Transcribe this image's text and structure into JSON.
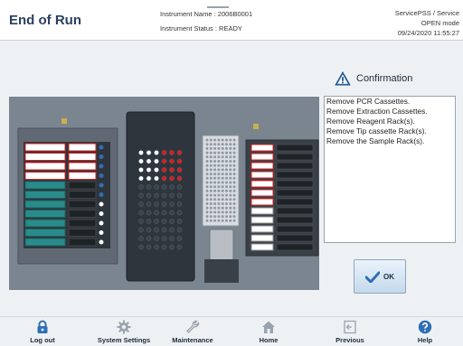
{
  "header": {
    "title": "End of Run",
    "instrument_name": "Instrument Name : 2006B0001",
    "instrument_status": "Instrument Status : READY",
    "user": "ServicePSS / Service",
    "mode": "OPEN mode",
    "datetime": "09/24/2020 11:55:27"
  },
  "confirmation": {
    "title": "Confirmation",
    "messages": [
      "Remove PCR Cassettes.",
      "Remove Extraction Cassettes.",
      "Remove Reagent Rack(s).",
      "Remove Tip cassette Rack(s).",
      "Remove the Sample Rack(s)."
    ],
    "ok_label": "OK"
  },
  "footer": {
    "buttons": [
      {
        "label": "Log out",
        "icon": "lock-icon"
      },
      {
        "label": "System Settings",
        "icon": "gear-icon"
      },
      {
        "label": "Maintenance",
        "icon": "wrench-icon"
      },
      {
        "label": "Home",
        "icon": "home-icon"
      },
      {
        "label": "Previous",
        "icon": "previous-icon"
      },
      {
        "label": "Help",
        "icon": "help-icon"
      }
    ]
  },
  "colors": {
    "accent": "#2f6fb5",
    "highlight_red": "#d42020",
    "panel": "#7b8590"
  }
}
